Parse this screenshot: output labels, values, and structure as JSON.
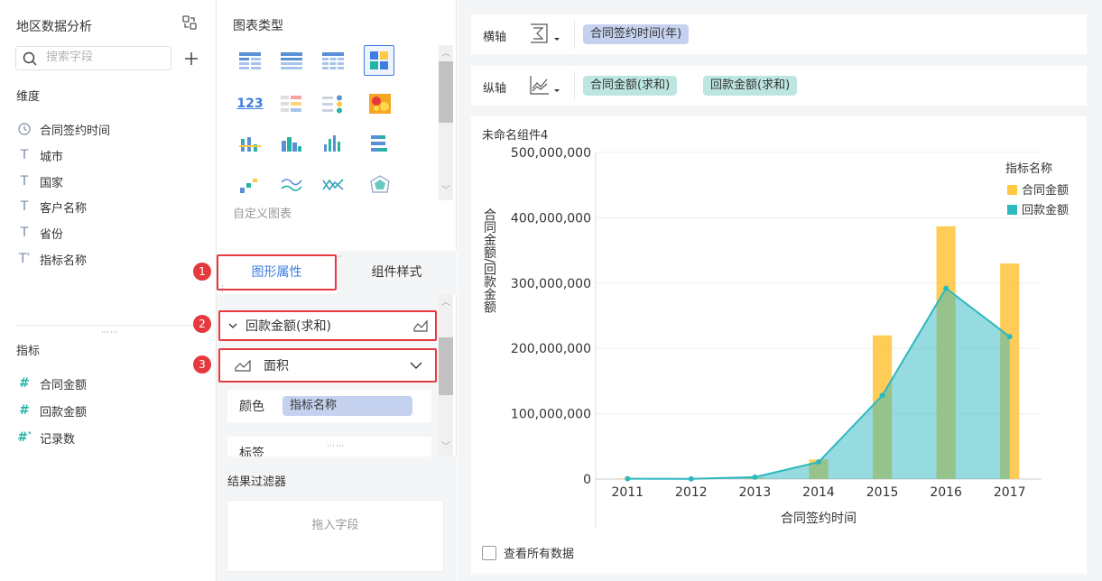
{
  "left_panel": {
    "title": "地区数据分析",
    "search": {
      "placeholder": "搜索字段",
      "value": ""
    },
    "dimensions": {
      "label": "维度",
      "items": [
        {
          "label": "合同签约时间",
          "icon": "clock-icon"
        },
        {
          "label": "城市",
          "icon": "text-type-icon"
        },
        {
          "label": "国家",
          "icon": "text-type-icon"
        },
        {
          "label": "客户名称",
          "icon": "text-type-icon"
        },
        {
          "label": "省份",
          "icon": "text-type-icon"
        },
        {
          "label": "指标名称",
          "icon": "text-type-star-icon"
        }
      ]
    },
    "metrics": {
      "label": "指标",
      "items": [
        {
          "label": "合同金额",
          "icon": "hash-icon"
        },
        {
          "label": "回款金额",
          "icon": "hash-icon"
        },
        {
          "label": "记录数",
          "icon": "hash-star-icon"
        }
      ]
    }
  },
  "middle_panel": {
    "chart_type_title": "图表类型",
    "custom_chart_label": "自定义图表",
    "tabs": [
      {
        "label": "图形属性",
        "active": true
      },
      {
        "label": "组件样式",
        "active": false
      }
    ],
    "series_row": {
      "label": "回款金额(求和)"
    },
    "shape_row": {
      "label": "面积"
    },
    "color_row": {
      "label": "颜色",
      "field": "指标名称"
    },
    "label_row": {
      "label": "标签"
    },
    "badges": [
      "1",
      "2",
      "3"
    ],
    "result_filter": {
      "title": "结果过滤器",
      "drop_hint": "拖入字段"
    }
  },
  "right_panel": {
    "x_axis": {
      "label": "横轴",
      "fields": [
        "合同签约时间(年)"
      ]
    },
    "y_axis": {
      "label": "纵轴",
      "fields": [
        "合同金额(求和)",
        "回款金额(求和)"
      ]
    },
    "component_title": "未命名组件4",
    "view_all_label": "查看所有数据"
  },
  "colors": {
    "accent": "#3f7de0",
    "highlight": "#e6393d",
    "bar_series": "#ffc845",
    "area_series": "#2eb8bf"
  },
  "chart_data": {
    "type": "bar+area",
    "categories": [
      "2011",
      "2012",
      "2013",
      "2014",
      "2015",
      "2016",
      "2017"
    ],
    "series": [
      {
        "name": "合同金额",
        "type": "bar",
        "color": "#ffc845",
        "values": [
          1000000,
          500000,
          2000000,
          30000000,
          220000000,
          387000000,
          330000000
        ]
      },
      {
        "name": "回款金额",
        "type": "area",
        "color": "#2eb8bf",
        "values": [
          500000,
          300000,
          3000000,
          26000000,
          128000000,
          292000000,
          218000000
        ]
      }
    ],
    "xlabel": "合同签约时间",
    "ylabel": "合同金额/回款金额",
    "ylim": [
      0,
      500000000
    ],
    "yticks": [
      "0",
      "100,000,000",
      "200,000,000",
      "300,000,000",
      "400,000,000",
      "500,000,000"
    ],
    "legend_title": "指标名称",
    "legend_position": "top-right",
    "grid": true
  }
}
